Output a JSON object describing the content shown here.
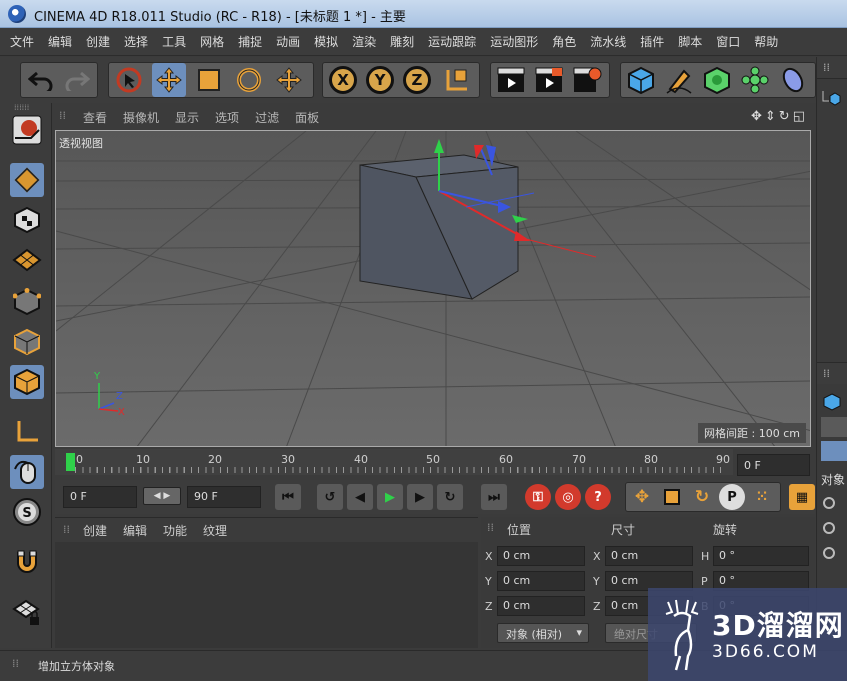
{
  "window": {
    "title": "CINEMA 4D R18.011 Studio (RC - R18) - [未标题 1 *] - 主要"
  },
  "menu": [
    "文件",
    "编辑",
    "创建",
    "选择",
    "工具",
    "网格",
    "捕捉",
    "动画",
    "模拟",
    "渲染",
    "雕刻",
    "运动跟踪",
    "运动图形",
    "角色",
    "流水线",
    "插件",
    "脚本",
    "窗口",
    "帮助"
  ],
  "viewport": {
    "menu": [
      "查看",
      "摄像机",
      "显示",
      "选项",
      "过滤",
      "面板"
    ],
    "label": "透视视图",
    "grid_spacing": "网格间距 : 100 cm",
    "axis_labels": {
      "y": "Y",
      "z": "Z",
      "x": "X"
    }
  },
  "timeline": {
    "ticks": [
      "0",
      "10",
      "20",
      "30",
      "40",
      "50",
      "60",
      "70",
      "80",
      "90"
    ],
    "end_field": "0 F"
  },
  "transport": {
    "current_frame": "0 F",
    "max_frame": "90 F"
  },
  "materials": {
    "menu": [
      "创建",
      "编辑",
      "功能",
      "纹理"
    ]
  },
  "coords": {
    "headers": {
      "position": "位置",
      "size": "尺寸",
      "rotation": "旋转"
    },
    "rows": [
      {
        "pos_label": "X",
        "pos": "0 cm",
        "size_label": "X",
        "size": "0 cm",
        "rot_label": "H",
        "rot": "0 °"
      },
      {
        "pos_label": "Y",
        "pos": "0 cm",
        "size_label": "Y",
        "size": "0 cm",
        "rot_label": "P",
        "rot": "0 °"
      },
      {
        "pos_label": "Z",
        "pos": "0 cm",
        "size_label": "Z",
        "size": "0 cm",
        "rot_label": "B",
        "rot": "0 °"
      }
    ],
    "mode_button": "对象 (相对)",
    "apply_button": "绝对尺寸"
  },
  "right_panel": {
    "attr_label": "对象"
  },
  "status": {
    "text": "增加立方体对象"
  },
  "watermark": {
    "name": "3D溜溜网",
    "url": "3D66.COM"
  }
}
